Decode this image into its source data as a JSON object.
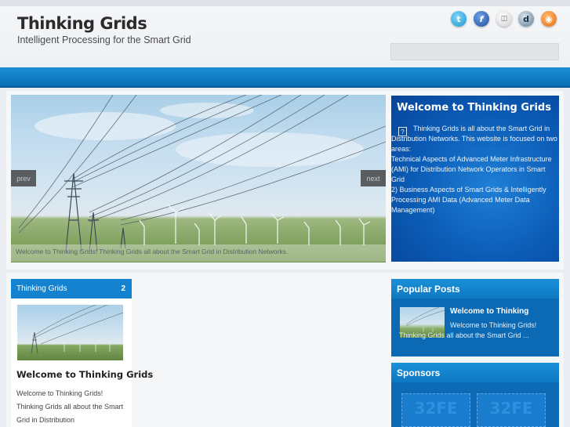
{
  "header": {
    "title": "Thinking Grids",
    "tagline": "Intelligent Processing for the Smart Grid",
    "social": [
      {
        "icon": "twitter-icon",
        "glyph": "t"
      },
      {
        "icon": "facebook-icon",
        "glyph": "f"
      },
      {
        "icon": "delicious-icon",
        "glyph": "◫"
      },
      {
        "icon": "digg-icon",
        "glyph": "d"
      },
      {
        "icon": "rss-icon",
        "glyph": "◉"
      }
    ]
  },
  "slider": {
    "prev_label": "prev",
    "next_label": "next",
    "caption": "Welcome to Thinking Grids! Thinking Grids all about the Smart Grid in Distribution Networks."
  },
  "welcome": {
    "title": "Welcome to Thinking Grids",
    "icon_glyph": "?",
    "intro": "Thinking Grids is all about the Smart Grid in Distribution Networks. This website is focused on two areas:",
    "point1": "Technical Aspects of Advanced Meter Infrastructure (AMI) for Distribution Network Operators in Smart Grid",
    "point2": "2) Business Aspects of Smart Grids & Intelligently Processing AMI Data (Advanced Meter Data Management)"
  },
  "tab": {
    "label": "Thinking Grids",
    "count": "2"
  },
  "post": {
    "title": "Welcome to Thinking Grids",
    "excerpt": "Welcome to Thinking Grids! Thinking Grids all about the Smart Grid in Distribution"
  },
  "popular": {
    "header": "Popular Posts",
    "title": "Welcome to Thinking",
    "excerpt": "Welcome to Thinking Grids! Thinking Grids all about the Smart Grid ..."
  },
  "sponsors": {
    "header": "Sponsors",
    "slots": [
      "32FE",
      "32FE"
    ]
  },
  "colors": {
    "accent": "#1482cf",
    "bar": "#0a6fb6",
    "welcome_bg": "#0b5cb6"
  }
}
